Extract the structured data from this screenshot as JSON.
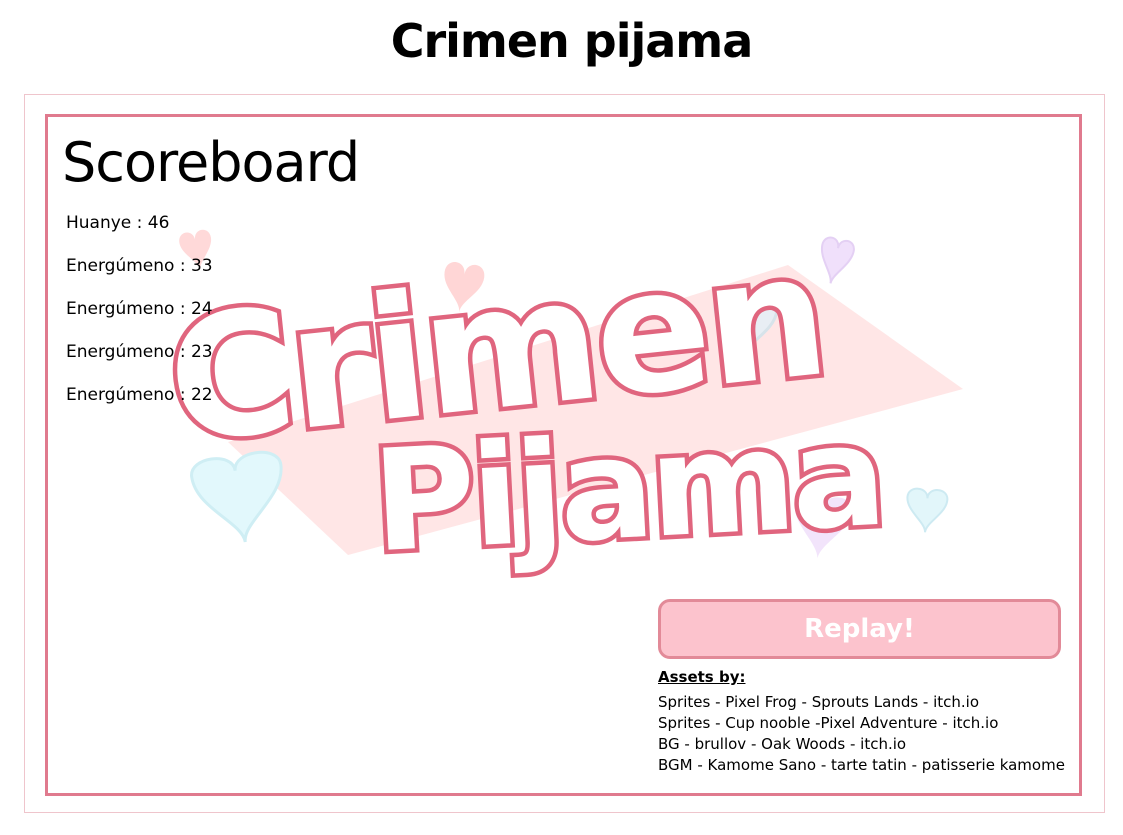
{
  "page": {
    "title": "Crimen pijama"
  },
  "game": {
    "logo_text": [
      "Crimen",
      "Pijama"
    ],
    "scoreboard": {
      "title": "Scoreboard",
      "entries": [
        "Huanye : 46",
        "Energúmeno : 33",
        "Energúmeno : 24",
        "Energúmeno : 23",
        "Energúmeno : 22"
      ]
    },
    "replay_label": "Replay!",
    "credits": {
      "heading": "Assets by:",
      "lines": [
        "Sprites - Pixel Frog - Sprouts Lands - itch.io",
        "Sprites - Cup nooble -Pixel Adventure - itch.io",
        "BG - brullov - Oak Woods - itch.io",
        "BGM - Kamome Sano - tarte tatin - patisserie kamome"
      ]
    }
  },
  "colors": {
    "frame_border": "#e07a8e",
    "logo_stroke": "#e0657e",
    "button_fill": "#fcc3cd",
    "button_border": "#e28a98",
    "band_fill": "#ffe3e3"
  }
}
